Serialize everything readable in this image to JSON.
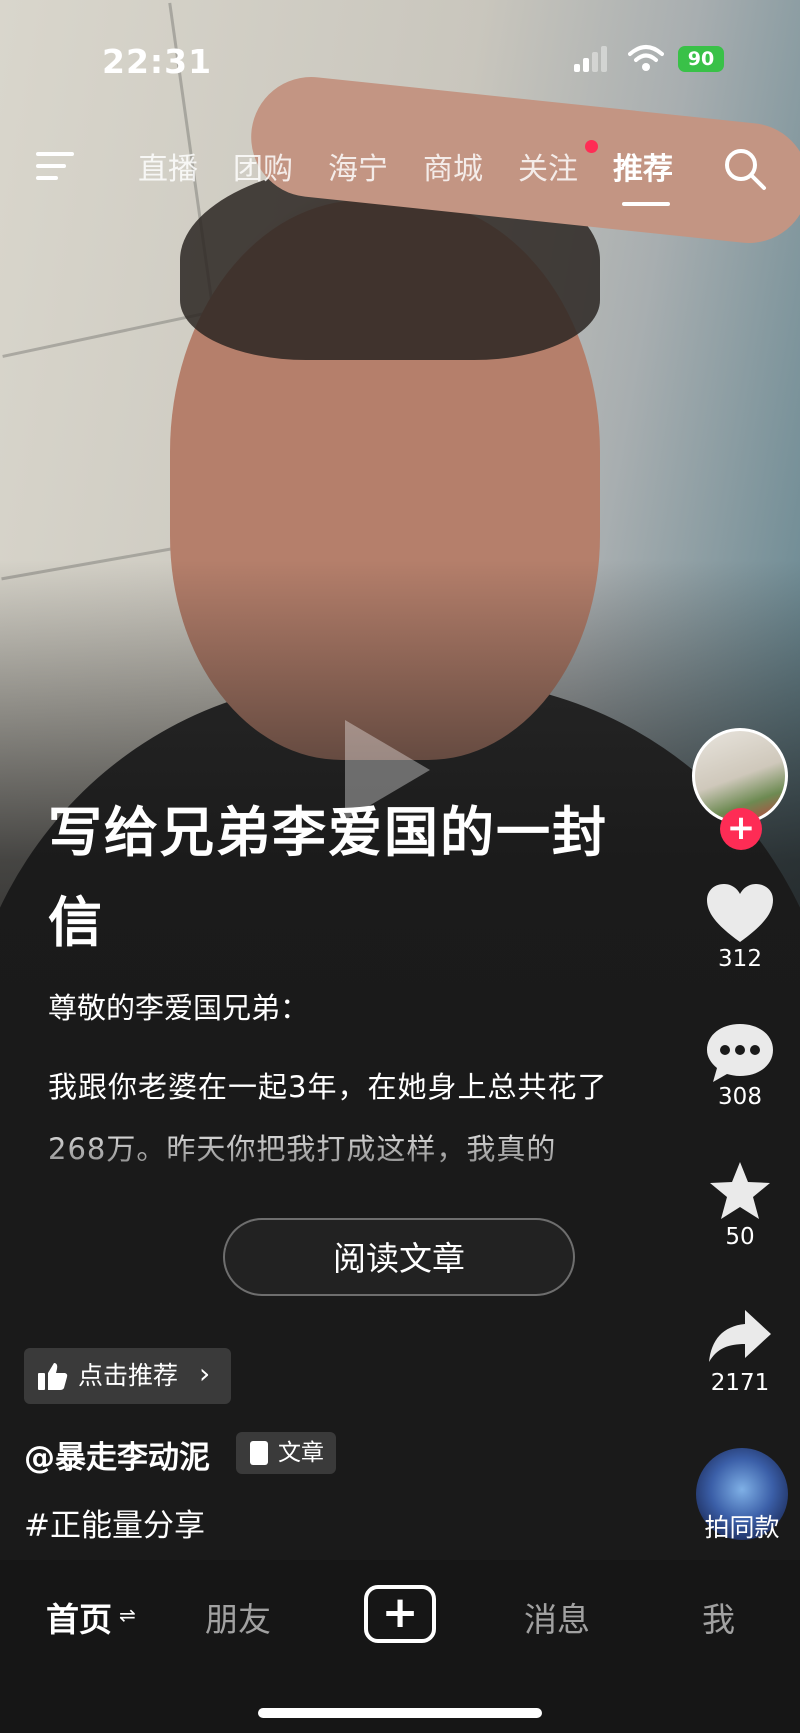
{
  "status": {
    "time": "22:31",
    "battery": "90"
  },
  "topnav": {
    "tabs": [
      "直播",
      "团购",
      "海宁",
      "商城",
      "关注",
      "推荐"
    ],
    "active": "推荐"
  },
  "post": {
    "title": "写给兄弟李爱国的一封信",
    "greeting": "尊敬的李爱国兄弟：",
    "body": "我跟你老婆在一起3年，在她身上总共花了268万。昨天你把我打成这样，我真的",
    "read_button": "阅读文章",
    "recommend": "点击推荐",
    "author": "@暴走李动泥",
    "article_tag": "文章",
    "hashtag": "#正能量分享"
  },
  "actions": {
    "follow": "+",
    "likes": "312",
    "comments": "308",
    "favorites": "50",
    "shares": "2171",
    "same_style": "拍同款"
  },
  "tabbar": {
    "home": "首页",
    "home_switch": "⇌",
    "friends": "朋友",
    "create": "+",
    "messages": "消息",
    "me": "我"
  },
  "colors": {
    "accent": "#fe2c55",
    "battery": "#39c148",
    "background": "#161616"
  }
}
